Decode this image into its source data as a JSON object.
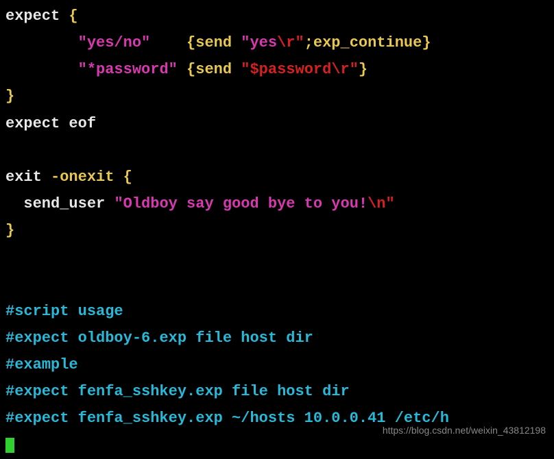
{
  "code": {
    "l1_expect": "expect ",
    "l1_brace": "{",
    "l2_str": "\"yes/no\"",
    "l2_send": "    {send ",
    "l2_yes": "\"yes",
    "l2_r": "\\r\"",
    "l2_cont": ";exp_continue}",
    "l3_str": "\"*password\"",
    "l3_send": " {send ",
    "l3_pwd": "\"$password",
    "l3_r": "\\r\"",
    "l3_close": "}",
    "l4_brace": "}",
    "l5_eof": "expect eof",
    "l6_blank": "",
    "l7_exit": "exit ",
    "l7_onexit": "-onexit {",
    "l8_send": "  send_user ",
    "l8_msg": "\"Oldboy say good bye to you!",
    "l8_n": "\\n\"",
    "l9_brace": "}",
    "l10_blank": "",
    "l11_blank": "",
    "c1": "#script usage",
    "c2": "#expect oldboy-6.exp file host dir",
    "c3": "#example",
    "c4": "#expect fenfa_sshkey.exp file host dir",
    "c5": "#expect fenfa_sshkey.exp ~/hosts 10.0.0.41 /etc/h"
  },
  "watermark": "https://blog.csdn.net/weixin_43812198"
}
